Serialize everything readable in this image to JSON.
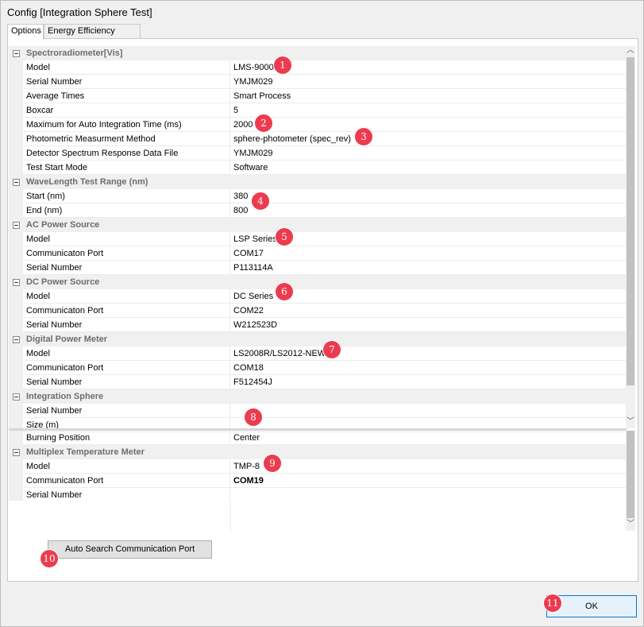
{
  "window": {
    "title": "Config [Integration Sphere Test]"
  },
  "tabs": [
    {
      "label": "Options",
      "active": true
    },
    {
      "label": "Energy Efficiency Class",
      "active": false
    }
  ],
  "grid": {
    "categories": {
      "spectro": "Spectroradiometer[Vis]",
      "wave": "WaveLength Test Range (nm)",
      "ac": "AC Power Source",
      "dc": "DC Power Source",
      "dpm": "Digital Power Meter",
      "sphere": "Integration Sphere",
      "mtm": "Multiplex Temperature Meter"
    },
    "spectro": {
      "model": {
        "label": "Model",
        "value": "LMS-9000"
      },
      "serial": {
        "label": "Serial Number",
        "value": "YMJM029"
      },
      "avg": {
        "label": "Average Times",
        "value": "Smart Process"
      },
      "boxcar": {
        "label": "Boxcar",
        "value": "5"
      },
      "maxint": {
        "label": "Maximum for Auto Integration Time (ms)",
        "value": "2000"
      },
      "photometric": {
        "label": "Photometric Measurment Method",
        "value": "sphere-photometer (spec_rev)"
      },
      "detector": {
        "label": "Detector Spectrum Response Data File",
        "value": "YMJM029"
      },
      "startmode": {
        "label": "Test Start Mode",
        "value": "Software"
      }
    },
    "wave": {
      "start": {
        "label": "Start (nm)",
        "value": "380"
      },
      "end": {
        "label": "End (nm)",
        "value": "800"
      }
    },
    "ac": {
      "model": {
        "label": "Model",
        "value": "LSP Series"
      },
      "port": {
        "label": "Communicaton Port",
        "value": "COM17"
      },
      "serial": {
        "label": "Serial Number",
        "value": "P113114A"
      }
    },
    "dc": {
      "model": {
        "label": "Model",
        "value": "DC Series"
      },
      "port": {
        "label": "Communicaton Port",
        "value": "COM22"
      },
      "serial": {
        "label": "Serial Number",
        "value": "W212523D"
      }
    },
    "dpm": {
      "model": {
        "label": "Model",
        "value": "LS2008R/LS2012-NEW"
      },
      "port": {
        "label": "Communicaton Port",
        "value": "COM18"
      },
      "serial": {
        "label": "Serial Number",
        "value": "F512454J"
      }
    },
    "sphere": {
      "serial": {
        "label": "Serial Number",
        "value": ""
      },
      "size": {
        "label": "Size (m)",
        "value": ""
      }
    },
    "lower": {
      "burning": {
        "label": "Burning Position",
        "value": "Center"
      }
    },
    "mtm": {
      "model": {
        "label": "Model",
        "value": "TMP-8"
      },
      "port": {
        "label": "Communicaton Port",
        "value": "COM19"
      },
      "serial": {
        "label": "Serial Number",
        "value": ""
      }
    }
  },
  "buttons": {
    "auto_search": "Auto Search Communication Port",
    "ok": "OK"
  },
  "badges": [
    "1",
    "2",
    "3",
    "4",
    "5",
    "6",
    "7",
    "8",
    "9",
    "10",
    "11"
  ],
  "colors": {
    "badge": "#ec3b4f",
    "category_text": "#6d6d6d",
    "ok_border": "#0078d7"
  },
  "icons": {
    "collapse": "minus-box-icon",
    "scroll_up": "chevron-up-icon",
    "scroll_down": "chevron-down-icon"
  }
}
